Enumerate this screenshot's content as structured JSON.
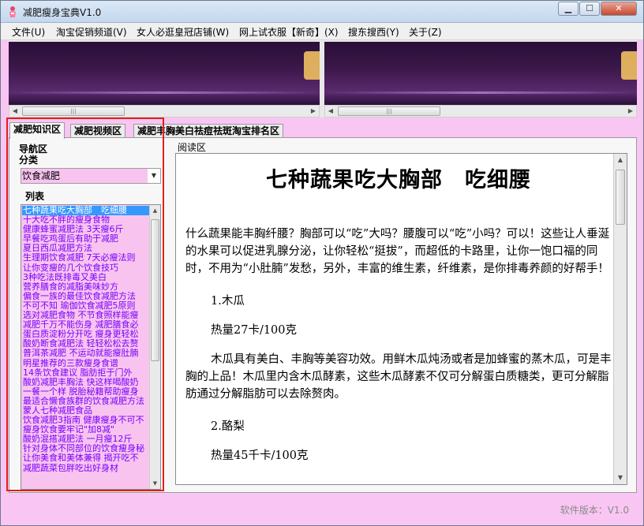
{
  "window": {
    "title": "减肥瘦身宝典V1.0",
    "min_glyph": "▁",
    "max_glyph": "☐",
    "close_glyph": "✕"
  },
  "menu": [
    "文件(U)",
    "淘宝促销频道(V)",
    "女人必逛皇冠店铺(W)",
    "网上试衣服【新奇】(X)",
    "搜东搜西(Y)",
    "关于(Z)"
  ],
  "scroll_glyphs": {
    "left": "◀",
    "right": "▶",
    "up": "▲",
    "down": "▼",
    "grip": "|||"
  },
  "tabs": [
    "减肥知识区",
    "减肥视频区",
    "减肥丰胸美白祛痘祛斑淘宝排名区"
  ],
  "nav": {
    "title": "导航区",
    "category_label": "分类",
    "category_value": "饮食减肥",
    "list_label": "列表",
    "items": [
      "七种蔬果吃大胸部　吃细腰",
      "十大吃不胖的瘦身食物",
      "健康蜂蜜减肥法 3天瘦6斤",
      "早餐吃鸡蛋后有助于减肥",
      "夏日西瓜减肥方法",
      "生理期饮食减肥 7天必瘦法则",
      "让你变瘦的几个饮食技巧",
      "3种吃法既排毒又美白",
      "营养膳食的减脂美味妙方",
      "偏食一族的最佳饮食减肥方法",
      "不可不知 瑜伽饮食减肥5原则",
      "选对减肥食物 不节食照样能瘦",
      "减肥千万不能伤身 减肥膳食必",
      "蛋白质淀粉分开吃 瘦身更轻松",
      "酸奶断食减肥法 轻轻松松去赘",
      "普洱茶减肥 不运动就能瘦肚腩",
      "明星推荐的三款瘦身食谱",
      "14条饮食建议 脂肪拒于门外",
      "酸奶减肥丰胸法 快这样喝酸奶",
      "一餐一个样 脱胎秘籍帮助瘦身",
      "最适合懒食族群的饮食减肥方法",
      "蒙人七种减肥食品",
      "饮食减肥3指南 健康瘦身不可不",
      "瘦身饮食要牢记\"加8减\"",
      "酸奶混搭减肥法 一月瘦12斤",
      "针对身体不同部位的饮食瘦身秘",
      "让你美食和美体兼得 揭开吃不",
      "减肥蔬菜包胖吃出好身材"
    ]
  },
  "reading": {
    "label": "阅读区",
    "title": "七种蔬果吃大胸部　吃细腰",
    "intro": "什么蔬果能丰胸纤腰？胸部可以“吃”大吗？腰腹可以“吃”小吗？可以！这些让人垂涎的水果可以促进乳腺分泌，让你轻松“挺拔”，而超低的卡路里，让你一饱口福的同时，不用为“小肚腩”发愁，另外，丰富的维生素，纤维素，是你排毒养颜的好帮手！",
    "sections": [
      {
        "heading": "1.木瓜",
        "calories": "热量27卡/100克",
        "body": "木瓜具有美白、丰胸等美容功效。用鲜木瓜炖汤或者是加蜂蜜的蒸木瓜，可是丰胸的上品！木瓜里内含木瓜酵素，这些木瓜酵素不仅可分解蛋白质糖类，更可分解脂肪通过分解脂肪可以去除赘肉。"
      },
      {
        "heading": "2.酪梨",
        "calories": "热量45千卡/100克"
      }
    ]
  },
  "footer": {
    "version": "软件版本：V1.0"
  }
}
